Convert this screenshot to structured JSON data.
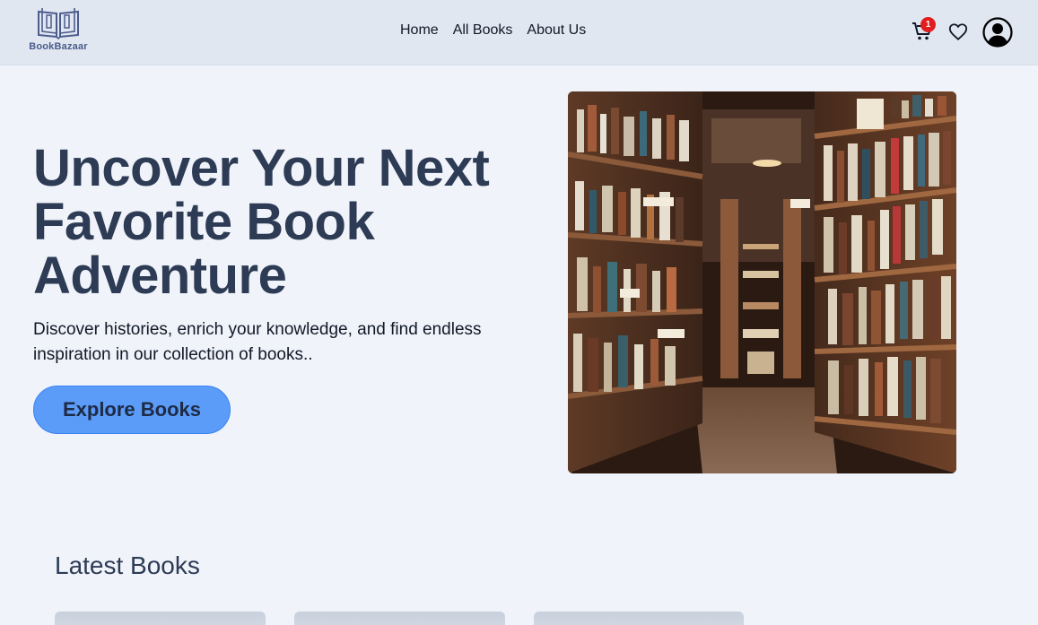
{
  "brand": {
    "name": "BookBazaar",
    "color": "#4b5b8c"
  },
  "nav": {
    "links": [
      "Home",
      "All Books",
      "About Us"
    ],
    "cart": {
      "icon": "cart-icon",
      "badge": "1"
    },
    "wishlist": {
      "icon": "heart-icon"
    },
    "account": {
      "icon": "user-icon"
    }
  },
  "hero": {
    "title": "Uncover Your Next Favorite Book Adventure",
    "subtitle": "Discover histories, enrich your knowledge, and find endless inspiration in our collection of books..",
    "cta_label": "Explore Books",
    "accent_color": "#5a9cf8"
  },
  "latest": {
    "title": "Latest Books",
    "cards": [
      {},
      {},
      {}
    ]
  }
}
